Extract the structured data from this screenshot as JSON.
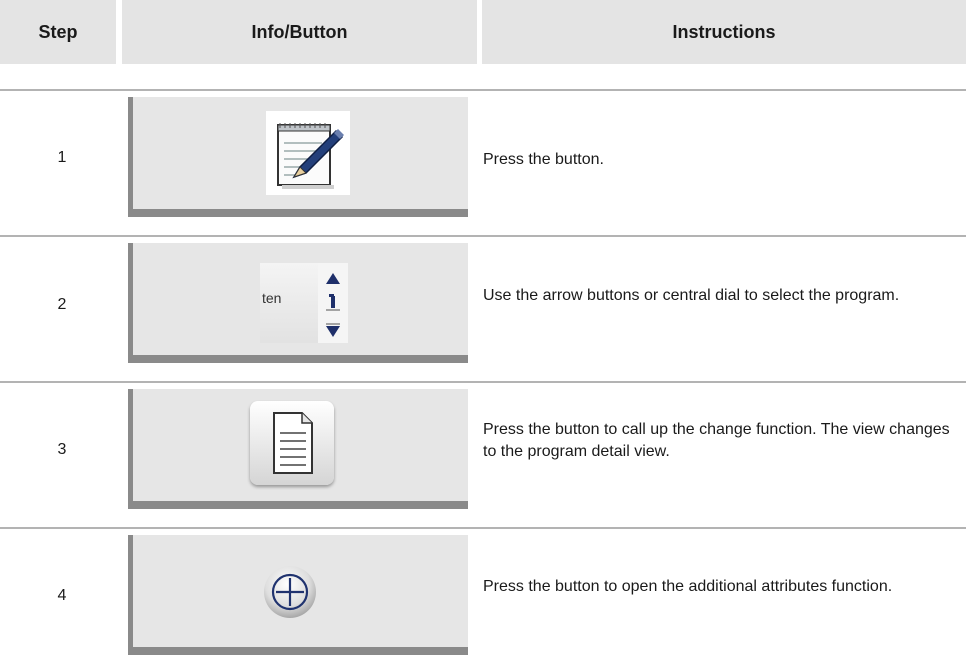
{
  "header": {
    "step": "Step",
    "info_button": "Info/Button",
    "instructions": "Instructions"
  },
  "rows": [
    {
      "step": "1",
      "icon": "notepad-pencil-icon",
      "instruction": "Press the button."
    },
    {
      "step": "2",
      "icon": "program-list-selector-icon",
      "selector_text": "ten",
      "instruction": "Use the arrow buttons or central dial to select the program."
    },
    {
      "step": "3",
      "icon": "document-icon",
      "instruction": "Press the button to call up the change function. The view changes to the program detail view."
    },
    {
      "step": "4",
      "icon": "plus-circle-icon",
      "instruction": "Press the button to open the additional attributes function."
    }
  ]
}
